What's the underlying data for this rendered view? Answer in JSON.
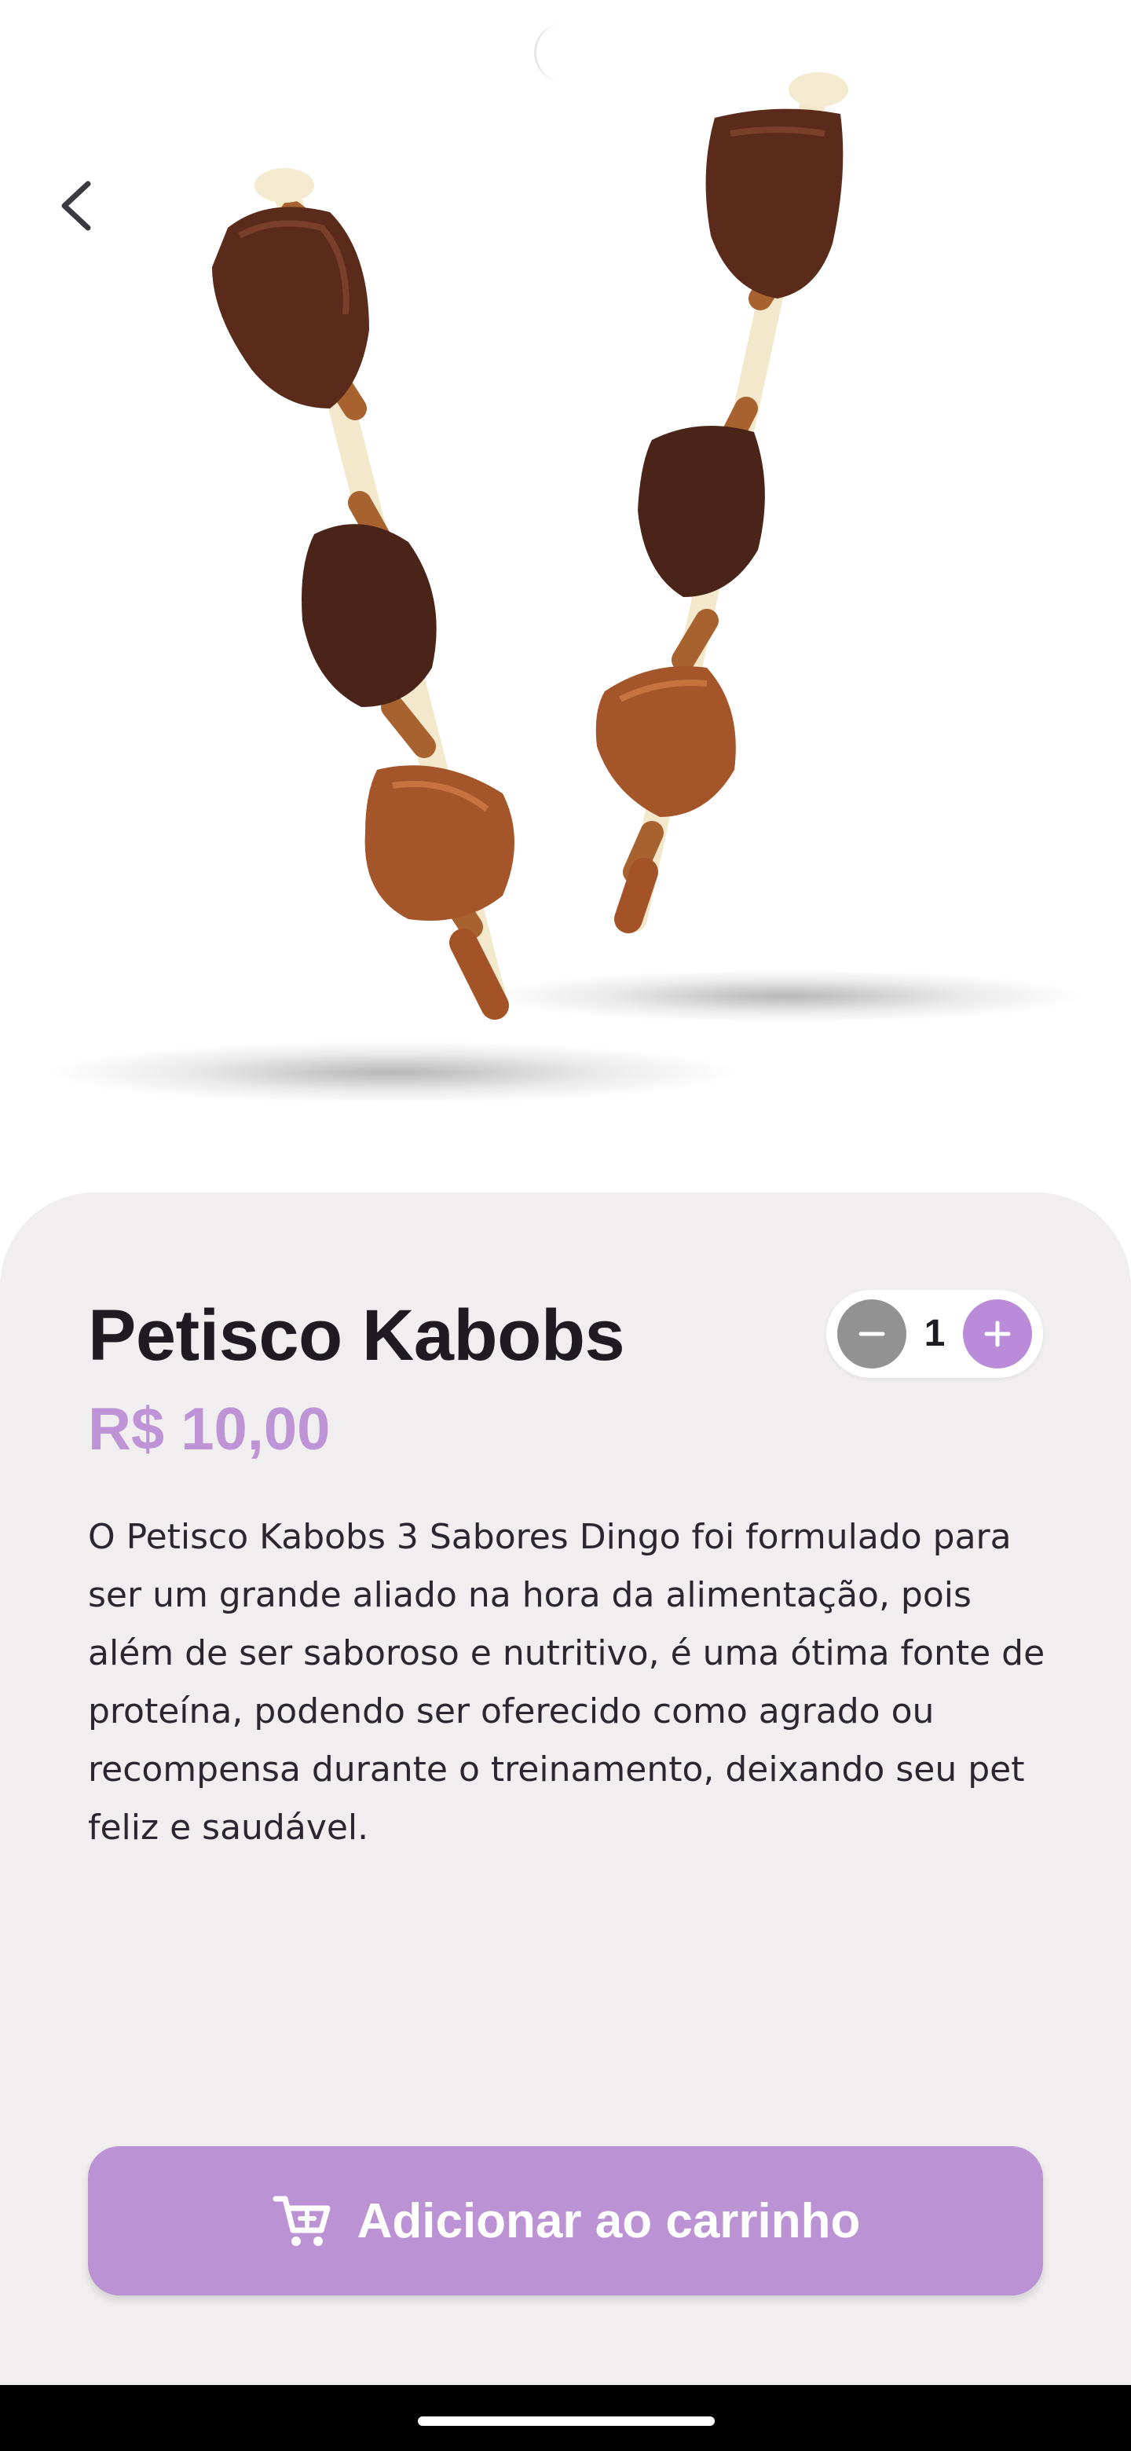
{
  "product": {
    "name": "Petisco Kabobs",
    "price": "R$ 10,00",
    "description": "O Petisco Kabobs 3 Sabores Dingo foi formulado para ser um grande aliado na hora da alimentação, pois além de ser saboroso e nutritivo, é uma ótima fonte de proteína, podendo ser oferecido como agrado ou recompensa durante o treinamento, deixando seu pet feliz e saudável."
  },
  "quantity": {
    "value": "1",
    "minus_icon": "minus-icon",
    "plus_icon": "plus-icon"
  },
  "actions": {
    "add_to_cart_label": "Adicionar ao carrinho",
    "cart_icon": "shopping-cart-icon"
  },
  "navigation": {
    "back_icon": "chevron-left-icon"
  },
  "colors": {
    "accent": "#bb92d4",
    "price": "#be94d6",
    "panel_background": "#f0eeee",
    "minus_button": "#929292",
    "plus_button": "#b98bd8",
    "text": "#1e1c22"
  }
}
